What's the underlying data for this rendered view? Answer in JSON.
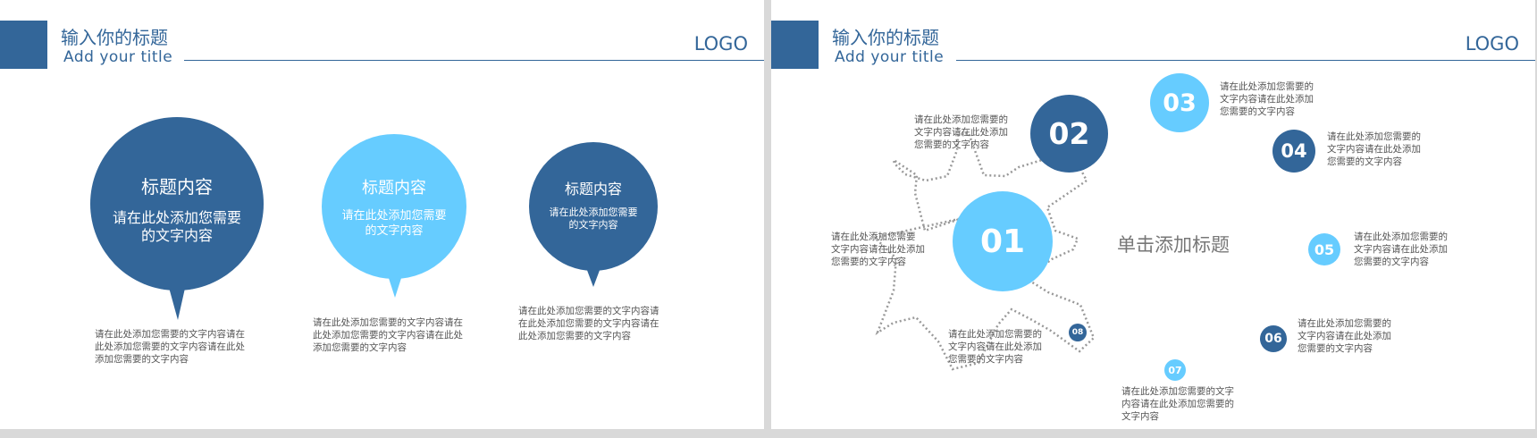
{
  "slide_left": {
    "header": {
      "title": "输入你的标题",
      "subtitle": "Add your title",
      "logo": "LOGO"
    },
    "bubbles": [
      {
        "title": "标题内容",
        "body_line1": "请在此处添加您需要",
        "body_line2": "的文字内容",
        "caption": [
          "请在此处添加您需要的文字内容请在",
          "此处添加您需要的文字内容请在此处",
          "添加您需要的文字内容"
        ]
      },
      {
        "title": "标题内容",
        "body_line1": "请在此处添加您需要",
        "body_line2": "的文字内容",
        "caption": [
          "请在此处添加您需要的文字内容请在",
          "此处添加您需要的文字内容请在此处",
          "添加您需要的文字内容"
        ]
      },
      {
        "title": "标题内容",
        "body_line1": "请在此处添加您需要",
        "body_line2": "的文字内容",
        "caption": [
          "请在此处添加您需要的文字内容请",
          "在此处添加您需要的文字内容请在",
          "此处添加您需要的文字内容"
        ]
      }
    ],
    "colors": {
      "dark": "#336699",
      "light": "#66ccff"
    }
  },
  "slide_right": {
    "header": {
      "title": "输入你的标题",
      "subtitle": "Add your title",
      "logo": "LOGO"
    },
    "center_title": "单击添加标题",
    "nodes": [
      {
        "num": "01",
        "text": [
          "请在此处添加您需要",
          "文字内容请在此处添加",
          "您需要的文字内容"
        ]
      },
      {
        "num": "02",
        "text": [
          "请在此处添加您需要的",
          "文字内容请在此处添加",
          "您需要的文字内容"
        ]
      },
      {
        "num": "03",
        "text": [
          "请在此处添加您需要的",
          "文字内容请在此处添加",
          "您需要的文字内容"
        ]
      },
      {
        "num": "04",
        "text": [
          "请在此处添加您需要的",
          "文字内容请在此处添加",
          "您需要的文字内容"
        ]
      },
      {
        "num": "05",
        "text": [
          "请在此处添加您需要的",
          "文字内容请在此处添加",
          "您需要的文字内容"
        ]
      },
      {
        "num": "06",
        "text": [
          "请在此处添加您需要的",
          "文字内容请在此处添加",
          "您需要的文字内容"
        ]
      },
      {
        "num": "07",
        "text": [
          "请在此处添加您需要的文字",
          "内容请在此处添加您需要的",
          "文字内容"
        ]
      },
      {
        "num": "08",
        "text": [
          "请在此处添加您需要的",
          "文字内容请在此处添加",
          "您需要的文字内容"
        ]
      }
    ]
  }
}
